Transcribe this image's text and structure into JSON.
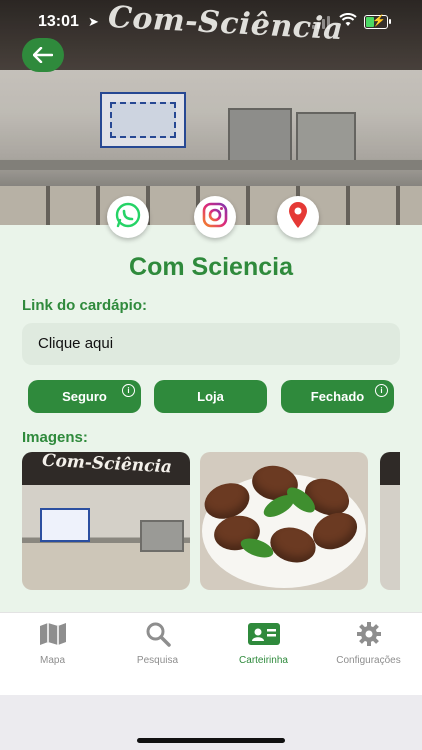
{
  "status_bar": {
    "time": "13:01"
  },
  "hero": {
    "banner_text": "Com-Sciência"
  },
  "social": [
    {
      "name": "whatsapp",
      "icon": "whatsapp-icon",
      "color": "#25d366"
    },
    {
      "name": "instagram",
      "icon": "instagram-icon",
      "color": "#c13584"
    },
    {
      "name": "map",
      "icon": "map-pin-icon",
      "color": "#e53935"
    }
  ],
  "place": {
    "title": "Com Sciencia"
  },
  "menu_link": {
    "label": "Link do cardápio:",
    "button": "Clique aqui"
  },
  "tags": [
    {
      "label": "Seguro",
      "info": "i"
    },
    {
      "label": "Loja"
    },
    {
      "label": "Fechado",
      "info": "i"
    }
  ],
  "images": {
    "label": "Imagens:",
    "thumb1_text": "Com-Sciência"
  },
  "tabbar": {
    "items": [
      {
        "label": "Mapa",
        "icon": "map-icon",
        "active": false
      },
      {
        "label": "Pesquisa",
        "icon": "search-icon",
        "active": false
      },
      {
        "label": "Carteirinha",
        "icon": "id-card-icon",
        "active": true
      },
      {
        "label": "Configurações",
        "icon": "gear-icon",
        "active": false
      }
    ]
  },
  "colors": {
    "accent": "#2f8a3c",
    "background": "#eaf4ea",
    "inactive": "#8e8e8e"
  }
}
